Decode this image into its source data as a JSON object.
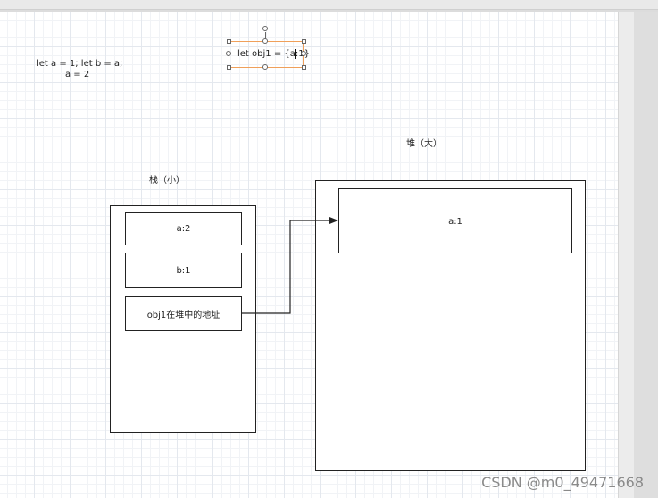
{
  "code": {
    "line1": "let a = 1; let b = a;",
    "line2": "a = 2"
  },
  "selected_text": "let obj1 = {a:1}",
  "stack": {
    "title": "栈（小）",
    "cells": [
      "a:2",
      "b:1",
      "obj1在堆中的地址"
    ]
  },
  "heap": {
    "title": "堆（大）",
    "item": "a:1"
  },
  "watermark": "CSDN @m0_49471668",
  "colors": {
    "selection_border": "#f0a05a",
    "stroke": "#222222",
    "grid": "#e4e8ee"
  }
}
